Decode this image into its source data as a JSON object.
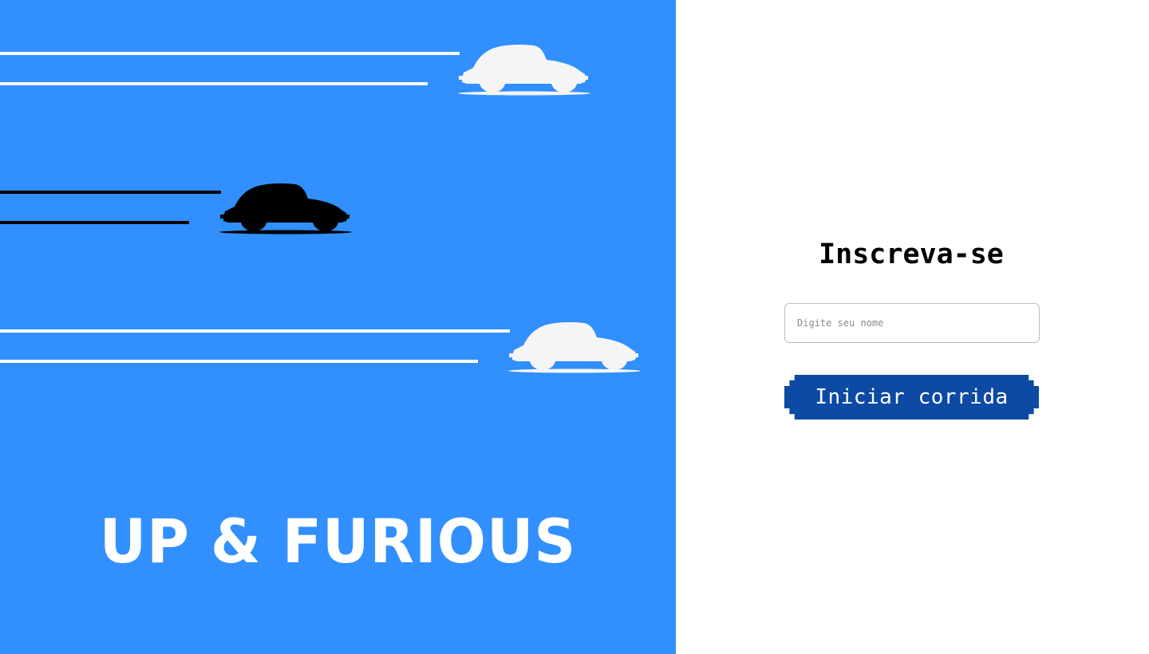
{
  "hero": {
    "brand_title": "UP & FURIOUS",
    "background_color": "#318ffe",
    "cars": [
      {
        "icon": "car-icon",
        "color": "#f5f5f5"
      },
      {
        "icon": "car-icon",
        "color": "#000000"
      },
      {
        "icon": "car-icon",
        "color": "#f5f5f5"
      }
    ]
  },
  "signup": {
    "title": "Inscreva-se",
    "name_input": {
      "value": "",
      "placeholder": "Digite seu nome"
    },
    "start_button_label": "Iniciar corrida",
    "start_button_color": "#0d4aa3"
  }
}
